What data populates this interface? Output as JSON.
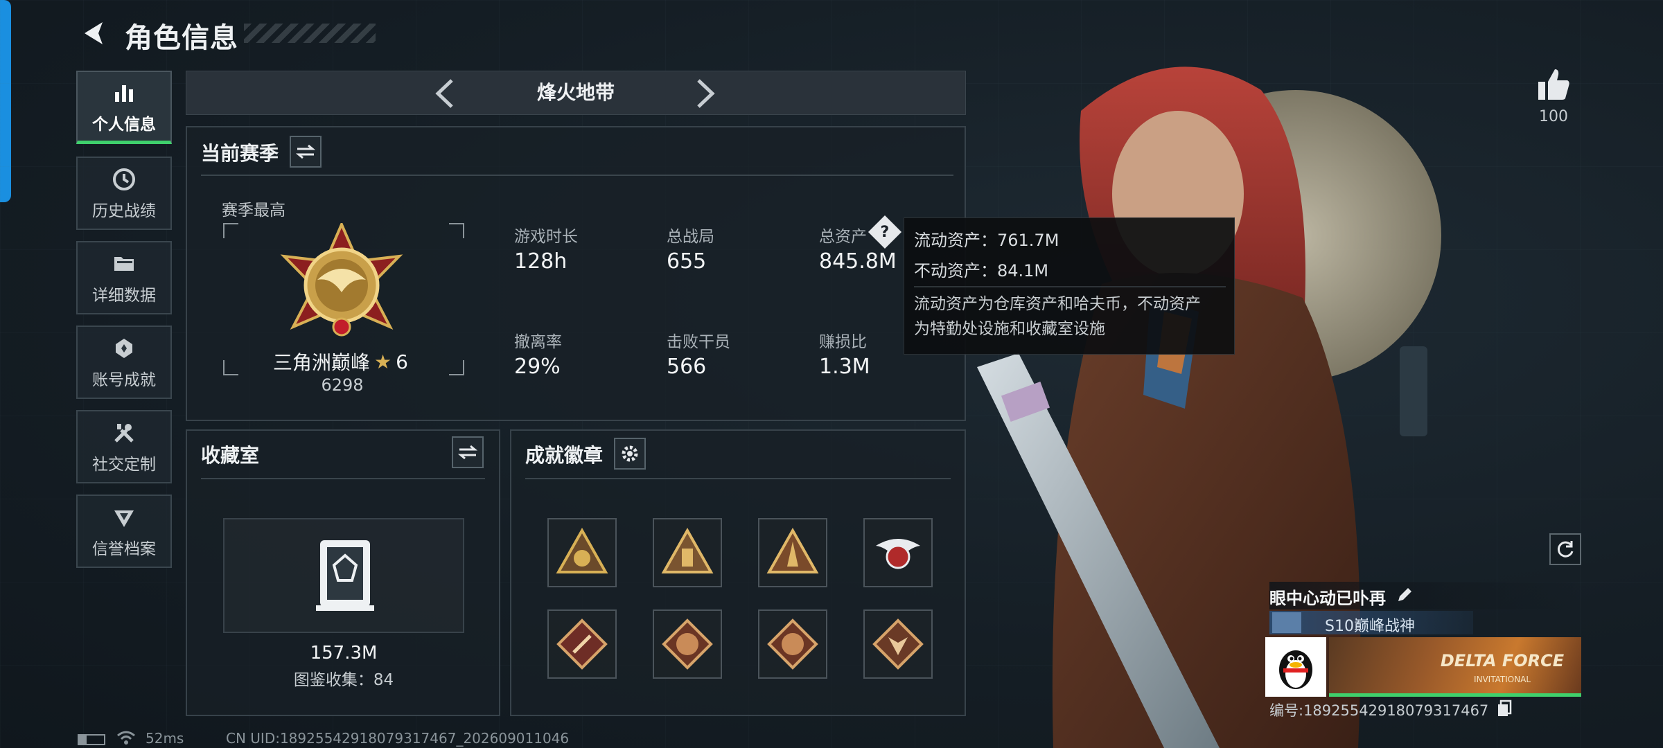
{
  "header": {
    "title": "角色信息"
  },
  "nav": [
    {
      "label": "个人信息",
      "icon": "bar-chart-icon",
      "active": true
    },
    {
      "label": "历史战绩",
      "icon": "history-clock-icon",
      "active": false
    },
    {
      "label": "详细数据",
      "icon": "folder-icon",
      "active": false
    },
    {
      "label": "账号成就",
      "icon": "achievement-icon",
      "active": false
    },
    {
      "label": "社交定制",
      "icon": "tools-icon",
      "active": false
    },
    {
      "label": "信誉档案",
      "icon": "credit-badge-icon",
      "active": false
    }
  ],
  "mode": {
    "title": "烽火地带"
  },
  "season": {
    "title": "当前赛季",
    "best_label": "赛季最高",
    "rank_name": "三角洲巅峰",
    "rank_stars": "6",
    "rank_score": "6298",
    "stats": [
      {
        "label": "游戏时长",
        "value": "128h"
      },
      {
        "label": "总战局",
        "value": "655"
      },
      {
        "label": "总资产",
        "value": "845.8M"
      },
      {
        "label": "撤离率",
        "value": "29%"
      },
      {
        "label": "击败干员",
        "value": "566"
      },
      {
        "label": "赚损比",
        "value": "1.3M"
      }
    ]
  },
  "tooltip": {
    "liquid": "流动资产：761.7M",
    "fixed": "不动资产：84.1M",
    "desc_line1": "流动资产为仓库资产和哈夫币，不动资产",
    "desc_line2": "为特勤处设施和收藏室设施"
  },
  "collection": {
    "title": "收藏室",
    "value": "157.3M",
    "catalog": "图鉴收集：84"
  },
  "badges": {
    "title": "成就徽章",
    "items": [
      "badge-1",
      "badge-2",
      "badge-3",
      "badge-4",
      "badge-5",
      "badge-6",
      "badge-7",
      "badge-8"
    ]
  },
  "likes": {
    "count": "100"
  },
  "player": {
    "name": "眼中心动已卟再",
    "title": "S10巅峰战神",
    "banner_text": "DELTA FORCE",
    "banner_sub": "INVITATIONAL",
    "id_text": "编号:1892554291807931746​7"
  },
  "status": {
    "ping": "52ms",
    "uid": "CN UID:18925542918079317467_202609011046"
  },
  "colors": {
    "accent_green": "#3fd06c",
    "side_tab_blue": "#1a8fe0",
    "rank_gold": "#d8b055"
  }
}
